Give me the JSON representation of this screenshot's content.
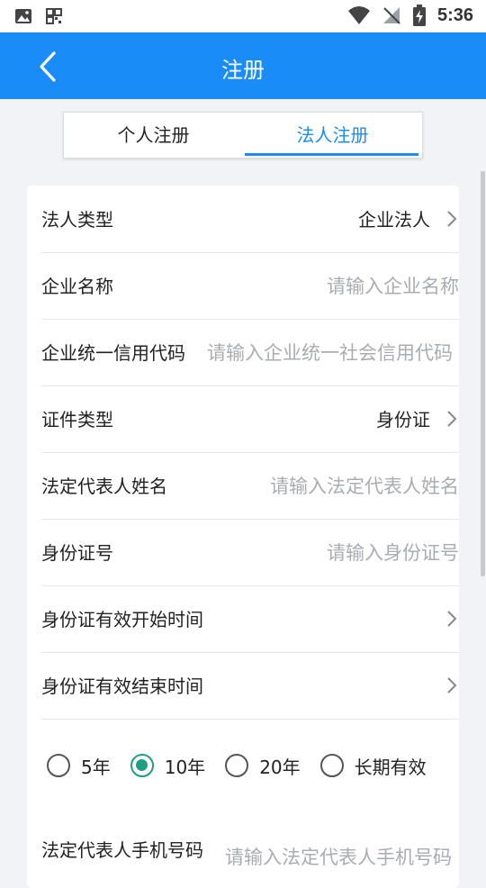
{
  "status": {
    "time": "5:36"
  },
  "header": {
    "title": "注册"
  },
  "tabs": [
    {
      "label": "个人注册",
      "active": false
    },
    {
      "label": "法人注册",
      "active": true
    }
  ],
  "form": {
    "legal_type": {
      "label": "法人类型",
      "value": "企业法人"
    },
    "company_name": {
      "label": "企业名称",
      "placeholder": "请输入企业名称"
    },
    "credit_code": {
      "label": "企业统一信用代码",
      "placeholder": "请输入企业统一社会信用代码"
    },
    "cert_type": {
      "label": "证件类型",
      "value": "身份证"
    },
    "rep_name": {
      "label": "法定代表人姓名",
      "placeholder": "请输入法定代表人姓名"
    },
    "id_number": {
      "label": "身份证号",
      "placeholder": "请输入身份证号"
    },
    "id_start": {
      "label": "身份证有效开始时间"
    },
    "id_end": {
      "label": "身份证有效结束时间"
    },
    "validity_options": [
      {
        "label": "5年",
        "checked": false
      },
      {
        "label": "10年",
        "checked": true
      },
      {
        "label": "20年",
        "checked": false
      },
      {
        "label": "长期有效",
        "checked": false
      }
    ],
    "rep_phone": {
      "label": "法定代表人手机号码",
      "placeholder": "请输入法定代表人手机号码"
    }
  },
  "colors": {
    "primary": "#1a8cf7",
    "radio_checked": "#1e9e82",
    "placeholder": "#a9acb1"
  }
}
